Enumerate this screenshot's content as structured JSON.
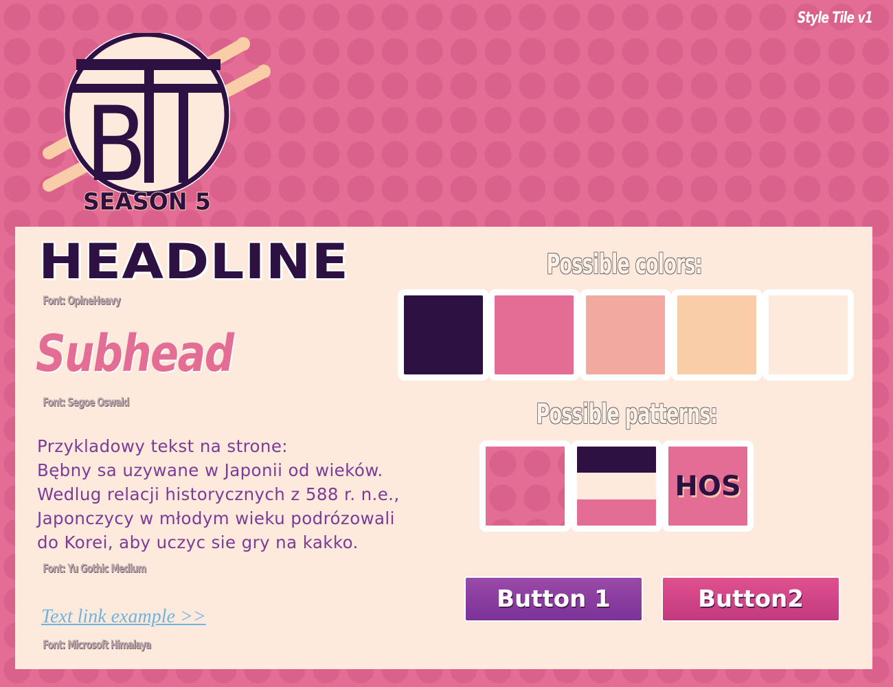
{
  "corner_label": "Style Tile v1",
  "logo": {
    "letters": "BTT",
    "season": "SEASON 5"
  },
  "typography": {
    "headline": "HEADLINE",
    "headline_font": "Font: OpineHeavy",
    "subhead": "Subhead",
    "subhead_font": "Font: Segoe Oswald",
    "body_lines": [
      "Przykladowy tekst na strone:",
      "Bębny sa uzywane w Japonii od wieków.",
      "Wedlug relacji historycznych z 588 r. n.e.,",
      "Japonczycy w młodym wieku podrózowali",
      "do Korei, aby uczyc sie gry na kakko."
    ],
    "body_font": "Font: Yu Gothic Medium",
    "link_text": "Text link example >>",
    "link_font": "Font: Microsoft Himalaya"
  },
  "colors": {
    "heading": "Possible colors:",
    "swatches": [
      "#2e1143",
      "#e46d95",
      "#f2aaa0",
      "#f8cda7",
      "#fdeadc"
    ]
  },
  "patterns": {
    "heading": "Possible patterns:",
    "items": [
      {
        "name": "dots"
      },
      {
        "name": "stripes"
      },
      {
        "name": "text",
        "label": "HOS"
      }
    ]
  },
  "buttons": {
    "button1": "Button 1",
    "button2": "Button2"
  }
}
